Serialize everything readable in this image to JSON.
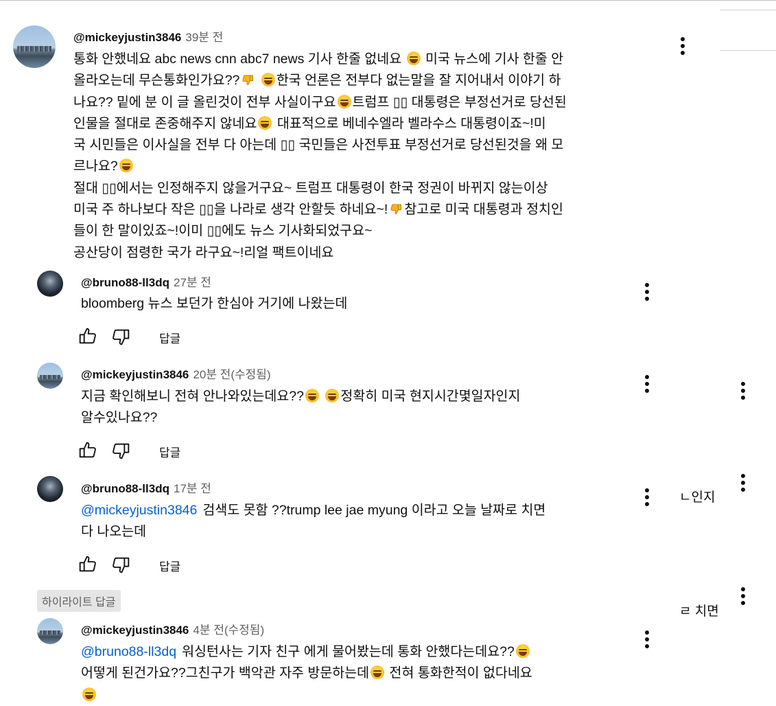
{
  "comments": [
    {
      "author": "@mickeyjustin3846",
      "time": "39분 전",
      "lines": [
        [
          "통화 안했네요 abc news cnn abc7 news 기사 한줄 없네요 ",
          "😅",
          " 미국 뉴스에 기사 한줄 안"
        ],
        [
          "올라오는데 무슨통화인가요??",
          "👎",
          " ",
          "😅",
          "한국 언론은 전부다 없는말을 잘 지어내서 이야기 하"
        ],
        [
          "나요?? 밑에 분 이 글 올린것이 전부 사실이구요",
          "😅",
          "트럼프 ▯▯ 대통령은 부정선거로 당선된"
        ],
        [
          "인물을 절대로 존중해주지 않네요",
          "😅",
          " 대표적으로 베네수엘라 벨라수스 대통령이죠~!미"
        ],
        [
          "국 시민들은 이사실을 전부 다 아는데 ▯▯ 국민들은 사전투표 부정선거로 당선된것을 왜 모"
        ],
        [
          "르나요?",
          "😅"
        ],
        [
          "절대 ▯▯에서는 인정해주지 않을거구요~ 트럼프 대통령이 한국 정권이 바뀌지 않는이상"
        ],
        [
          "미국 주 하나보다 작은 ▯▯을 나라로 생각 안할듯 하네요~!",
          "👎",
          "참고로 미국 대통령과 정치인"
        ],
        [
          "들이 한 말이있죠~!이미 ▯▯에도 뉴스 기사화되었구요~"
        ],
        [
          "공산당이 점령한 국가 라구요~!리얼 팩트이네요"
        ]
      ]
    }
  ],
  "replies": [
    {
      "author": "@bruno88-ll3dq",
      "time": "27분 전",
      "edited": "",
      "mention": "",
      "lines": [
        [
          "bloomberg 뉴스 보던가 한심아 거기에 나왔는데"
        ]
      ],
      "reply_label": "답글"
    },
    {
      "author": "@mickeyjustin3846",
      "time": "20분 전",
      "edited": "(수정됨)",
      "mention": "",
      "lines": [
        [
          "지금 확인해보니 전혀 안나와있는데요??",
          "😅",
          " ",
          "😅",
          "정확히 미국 현지시간몇일자인지"
        ],
        [
          "알수있나요??"
        ]
      ],
      "reply_label": "답글"
    },
    {
      "author": "@bruno88-ll3dq",
      "time": "17분 전",
      "edited": "",
      "mention": "@mickeyjustin3846",
      "lines": [
        [
          "검색도 못함  ??trump lee jae myung 이라고 오늘 날짜로 치면"
        ],
        [
          "다 나오는데"
        ]
      ],
      "reply_label": "답글"
    },
    {
      "author": "@mickeyjustin3846",
      "time": "4분 전",
      "edited": "(수정됨)",
      "mention": "@bruno88-ll3dq",
      "lines": [
        [
          "워싱턴사는 기자 친구 에게 물어봤는데 통화 안했다는데요??",
          "😅"
        ],
        [
          "어떻게 된건가요??그친구가 백악관 자주 방문하는데",
          "😅",
          " 전혀 통화한적이 없다네요"
        ],
        [
          "😅"
        ]
      ],
      "reply_label": ""
    }
  ],
  "highlight_label": "하이라이트 답글",
  "background_fragments": [
    "ㄴ인지",
    "ㄹ 치면"
  ],
  "icons": {
    "more": "more-vert-icon",
    "like": "thumb-up-icon",
    "dislike": "thumb-down-icon",
    "emoji_sweat": "grinning-sweat-emoji",
    "emoji_thumbdown": "thumbs-down-emoji"
  }
}
